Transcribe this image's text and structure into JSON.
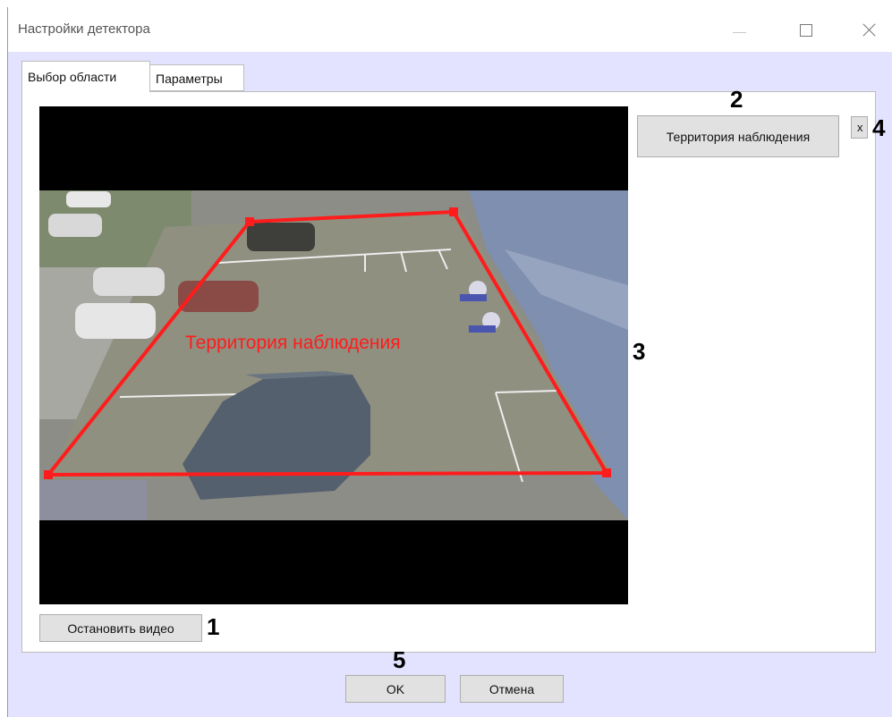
{
  "window": {
    "title": "Настройки детектора"
  },
  "tabs": [
    {
      "label": "Выбор области",
      "active": true
    },
    {
      "label": "Параметры",
      "active": false
    }
  ],
  "video": {
    "zone_label": "Территория наблюдения",
    "zone_color": "#ff1c1c"
  },
  "zone_list": {
    "zone_button_label": "Территория наблюдения",
    "remove_label": "x"
  },
  "buttons": {
    "stop_video": "Остановить видео",
    "ok": "OK",
    "cancel": "Отмена"
  },
  "callouts": [
    "1",
    "2",
    "3",
    "4",
    "5"
  ],
  "colors": {
    "window_background": "#e3e3ff",
    "zone_outline": "#ff1c1c"
  }
}
